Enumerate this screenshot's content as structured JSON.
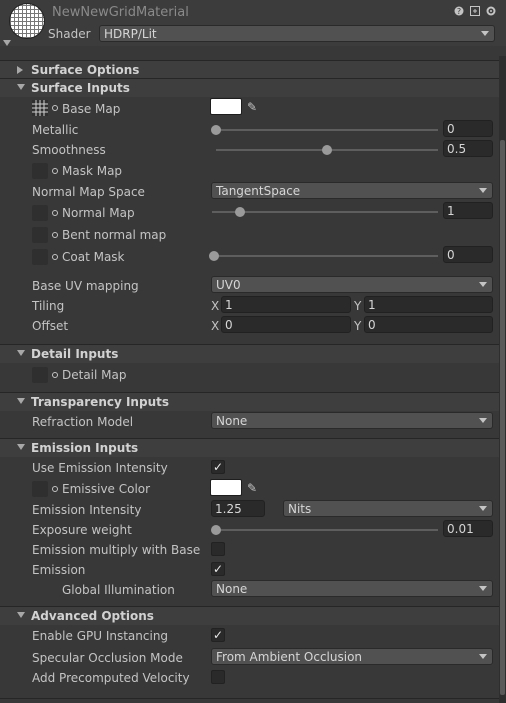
{
  "header": {
    "material_name": "NewNewGridMaterial",
    "shader_label": "Shader",
    "shader_value": "HDRP/Lit",
    "icons": [
      "help-icon",
      "preset-icon",
      "gear-icon"
    ]
  },
  "sections": {
    "surface_options": "Surface Options",
    "surface_inputs": "Surface Inputs",
    "detail_inputs": "Detail Inputs",
    "transparency_inputs": "Transparency Inputs",
    "emission_inputs": "Emission Inputs",
    "advanced_options": "Advanced Options"
  },
  "surface_inputs": {
    "base_map": "Base Map",
    "base_color": "#ffffff",
    "metallic_label": "Metallic",
    "metallic_value": "0",
    "metallic_fraction": 0,
    "smoothness_label": "Smoothness",
    "smoothness_value": "0.5",
    "smoothness_fraction": 0.5,
    "mask_map": "Mask Map",
    "normal_map_space_label": "Normal Map Space",
    "normal_map_space_value": "TangentSpace",
    "normal_map": "Normal Map",
    "normal_map_value": "1",
    "normal_map_fraction": 0.125,
    "bent_normal_map": "Bent normal map",
    "coat_mask": "Coat Mask",
    "coat_mask_value": "0",
    "coat_mask_fraction": 0,
    "base_uv_mapping_label": "Base UV mapping",
    "base_uv_mapping_value": "UV0",
    "tiling_label": "Tiling",
    "tiling_x": "1",
    "tiling_y": "1",
    "offset_label": "Offset",
    "offset_x": "0",
    "offset_y": "0",
    "x_label": "X",
    "y_label": "Y"
  },
  "detail_inputs": {
    "detail_map": "Detail Map"
  },
  "transparency_inputs": {
    "refraction_model_label": "Refraction Model",
    "refraction_model_value": "None"
  },
  "emission_inputs": {
    "use_emission_intensity": "Use Emission Intensity",
    "use_emission_intensity_checked": true,
    "emissive_color": "Emissive Color",
    "emissive_color_hex": "#ffffff",
    "emission_intensity_label": "Emission Intensity",
    "emission_intensity_value": "1.25",
    "emission_unit_value": "Nits",
    "exposure_weight_label": "Exposure weight",
    "exposure_weight_value": "0.01",
    "exposure_weight_fraction": 0.01,
    "emission_multiply_label": "Emission multiply with Base",
    "emission_multiply_checked": false,
    "emission_label": "Emission",
    "emission_checked": true,
    "global_illumination_label": "Global Illumination",
    "global_illumination_value": "None"
  },
  "advanced_options": {
    "gpu_instancing_label": "Enable GPU Instancing",
    "gpu_instancing_checked": true,
    "specular_occlusion_label": "Specular Occlusion Mode",
    "specular_occlusion_value": "From Ambient Occlusion",
    "precomputed_velocity_label": "Add Precomputed Velocity",
    "precomputed_velocity_checked": false
  },
  "checkmark": "✓"
}
